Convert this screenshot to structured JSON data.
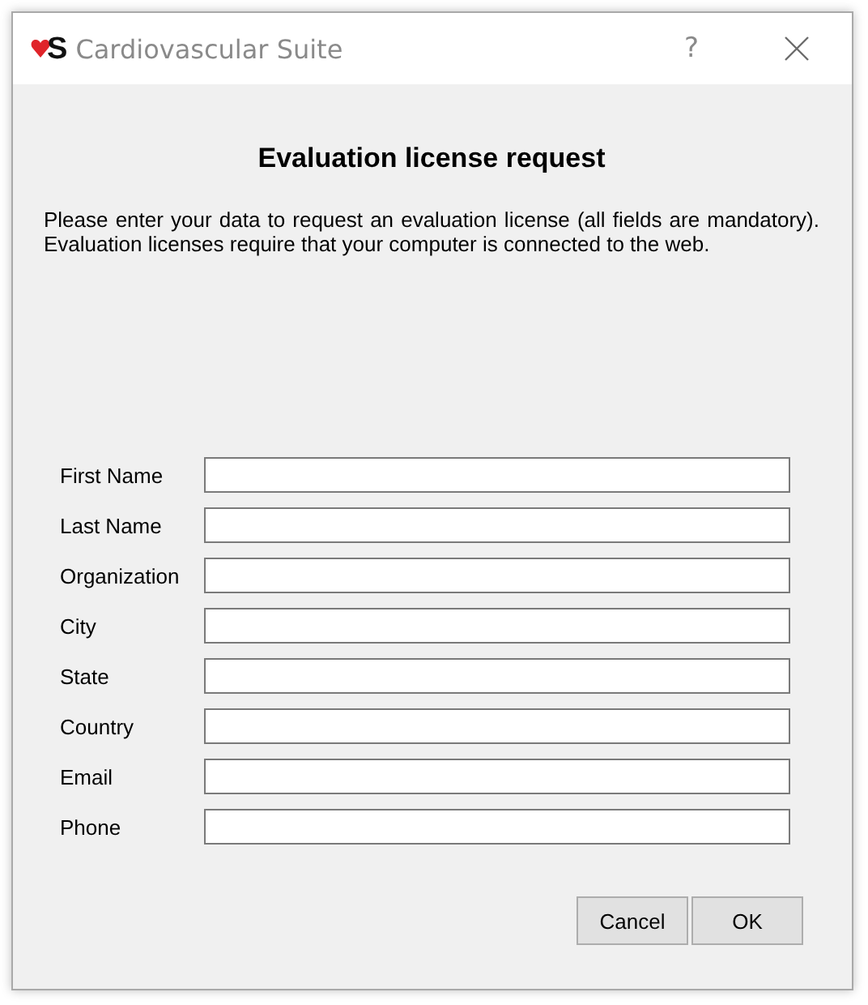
{
  "window": {
    "logo_text": "S",
    "title": "Cardiovascular Suite",
    "help": "?"
  },
  "heading": "Evaluation license request",
  "description": "Please enter your data to request an evaluation license (all fields are mandatory). Evaluation licenses require that your computer is connected to the web.",
  "fields": [
    {
      "label": "First Name"
    },
    {
      "label": "Last Name"
    },
    {
      "label": "Organization"
    },
    {
      "label": "City"
    },
    {
      "label": "State"
    },
    {
      "label": "Country"
    },
    {
      "label": "Email"
    },
    {
      "label": "Phone"
    }
  ],
  "buttons": [
    "Cancel",
    "OK"
  ]
}
